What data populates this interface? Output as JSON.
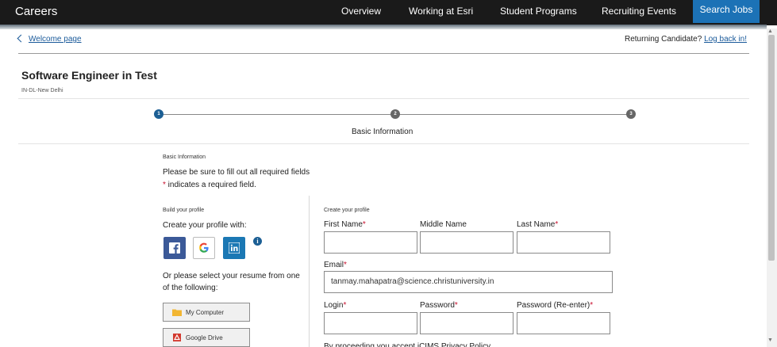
{
  "header": {
    "brand": "Careers",
    "nav": [
      "Overview",
      "Working at Esri",
      "Student Programs",
      "Recruiting Events"
    ],
    "search_button": "Search Jobs"
  },
  "subheader": {
    "back_link": "Welcome page",
    "returning_text": "Returning Candidate?",
    "login_link": "Log back in!"
  },
  "job": {
    "title": "Software Engineer in Test",
    "location": "IN-DL-New Delhi"
  },
  "steps": {
    "numbers": [
      "1",
      "2",
      "3"
    ],
    "current_index": 1,
    "current_label": "Basic Information",
    "active_color": "#1c5f94",
    "inactive_color": "#666666"
  },
  "form_intro": {
    "heading": "Basic Information",
    "instruction": "Please be sure to fill out all required fields",
    "required_mark": "*",
    "required_note": " indicates a required field."
  },
  "build_profile": {
    "heading": "Build your profile",
    "create_with": "Create your profile with:",
    "social": [
      "facebook-icon",
      "google-icon",
      "linkedin-icon"
    ],
    "info_icon": "i",
    "resume_prompt_1": "Or please select your resume from one",
    "resume_prompt_2": "of the following:",
    "my_computer": "My Computer",
    "google_drive": "Google Drive"
  },
  "create_profile": {
    "heading": "Create your profile",
    "first_name": "First Name",
    "middle_name": "Middle Name",
    "last_name": "Last Name",
    "email": "Email",
    "email_value": "tanmay.mahapatra@science.christuniversity.in",
    "login": "Login",
    "password": "Password",
    "password_reenter": "Password (Re-enter)",
    "required_mark": "*",
    "cutoff_text": "By proceeding you accept iCIMS Privacy Policy"
  }
}
